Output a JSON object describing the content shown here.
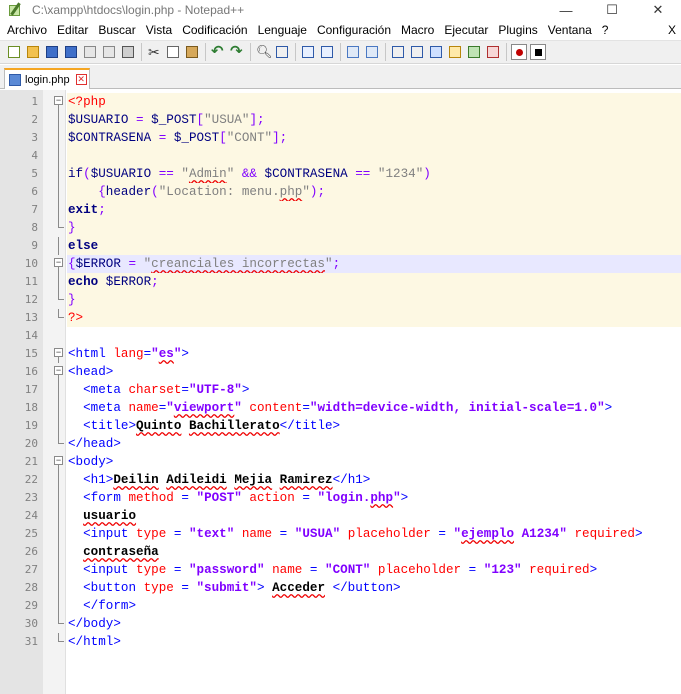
{
  "window": {
    "title": "C:\\xampp\\htdocs\\login.php - Notepad++",
    "minimize_glyph": "—",
    "maximize_glyph": "☐",
    "close_glyph": "✕"
  },
  "menu": {
    "items": [
      "Archivo",
      "Editar",
      "Buscar",
      "Vista",
      "Codificación",
      "Lenguaje",
      "Configuración",
      "Macro",
      "Ejecutar",
      "Plugins",
      "Ventana",
      "?"
    ],
    "close_doc": "X"
  },
  "toolbar": {
    "icons": [
      "new-file-icon",
      "open-file-icon",
      "save-icon",
      "save-all-icon",
      "close-icon",
      "close-all-icon",
      "print-icon",
      "cut-icon",
      "copy-icon",
      "paste-icon",
      "undo-icon",
      "redo-icon",
      "find-icon",
      "replace-icon",
      "zoom-in-icon",
      "zoom-out-icon",
      "sync-vertical-icon",
      "sync-horizontal-icon",
      "word-wrap-icon",
      "show-all-chars-icon",
      "indent-guide-icon",
      "user-lang-icon",
      "doc-map-icon",
      "function-list-icon",
      "record-macro-icon",
      "stop-macro-icon"
    ]
  },
  "tab": {
    "label": "login.php",
    "close_glyph": "✕"
  },
  "colors": {
    "php_bg": "#fdf8e3",
    "current_line_bg": "#e8e8ff",
    "tag": "#0000ff",
    "attribute": "#ff0000",
    "value": "#8000ff",
    "variable": "#000080",
    "string": "#808080",
    "tab_accent": "#f5a623"
  },
  "editor": {
    "lines": [
      {
        "n": "1",
        "t": [
          [
            "c-red",
            "<?php"
          ]
        ]
      },
      {
        "n": "2",
        "t": [
          [
            "c-var",
            "$USUARIO"
          ],
          [
            "c-op",
            " = "
          ],
          [
            "c-var",
            "$_POST"
          ],
          [
            "c-op",
            "["
          ],
          [
            "c-str",
            "\"USUA\""
          ],
          [
            "c-op",
            "];"
          ]
        ]
      },
      {
        "n": "3",
        "t": [
          [
            "c-var",
            "$CONTRASENA"
          ],
          [
            "c-op",
            " = "
          ],
          [
            "c-var",
            "$_POST"
          ],
          [
            "c-op",
            "["
          ],
          [
            "c-str",
            "\"CONT\""
          ],
          [
            "c-op",
            "];"
          ]
        ]
      },
      {
        "n": "4",
        "t": []
      },
      {
        "n": "5",
        "t": [
          [
            "c-kw",
            "if"
          ],
          [
            "c-op",
            "("
          ],
          [
            "c-var",
            "$USUARIO"
          ],
          [
            "c-op",
            " == "
          ],
          [
            "c-str",
            "\"Admin\""
          ],
          [
            "c-op",
            " && "
          ],
          [
            "c-var",
            "$CONTRASENA"
          ],
          [
            "c-op",
            " == "
          ],
          [
            "c-str",
            "\"1234\""
          ],
          [
            "c-op",
            ")"
          ]
        ]
      },
      {
        "n": "6",
        "t": [
          [
            "c-op",
            "    {"
          ],
          [
            "c-kw",
            "header"
          ],
          [
            "c-op",
            "("
          ],
          [
            "c-str",
            "\"Location: menu.php\""
          ],
          [
            "c-op",
            ");"
          ]
        ]
      },
      {
        "n": "7",
        "t": [
          [
            "c-kw c-bold",
            "exit"
          ],
          [
            "c-op",
            ";"
          ]
        ]
      },
      {
        "n": "8",
        "t": [
          [
            "c-op",
            "}"
          ]
        ]
      },
      {
        "n": "9",
        "t": [
          [
            "c-kw c-bold",
            "else"
          ]
        ]
      },
      {
        "n": "10",
        "t": [
          [
            "c-op",
            "{"
          ],
          [
            "c-var",
            "$ERROR"
          ],
          [
            "c-op",
            " = "
          ],
          [
            "c-str",
            "\"creanciales incorrectas\""
          ],
          [
            "c-op",
            ";"
          ]
        ]
      },
      {
        "n": "11",
        "t": [
          [
            "c-kw c-bold",
            "echo"
          ],
          [
            "c-var",
            " $ERROR"
          ],
          [
            "c-op",
            ";"
          ]
        ]
      },
      {
        "n": "12",
        "t": [
          [
            "c-op",
            "}"
          ]
        ]
      },
      {
        "n": "13",
        "t": [
          [
            "c-red",
            "?>"
          ]
        ]
      },
      {
        "n": "14",
        "t": []
      },
      {
        "n": "15",
        "t": [
          [
            "c-tag",
            "<html "
          ],
          [
            "c-attr",
            "lang"
          ],
          [
            "c-tag",
            "="
          ],
          [
            "c-val",
            "\"es\""
          ],
          [
            "c-tag",
            ">"
          ]
        ]
      },
      {
        "n": "16",
        "t": [
          [
            "c-tag",
            "<head>"
          ]
        ]
      },
      {
        "n": "17",
        "t": [
          [
            "c-tag",
            "  <meta "
          ],
          [
            "c-attr",
            "charset"
          ],
          [
            "c-tag",
            "="
          ],
          [
            "c-val",
            "\"UTF-8\""
          ],
          [
            "c-tag",
            ">"
          ]
        ]
      },
      {
        "n": "18",
        "t": [
          [
            "c-tag",
            "  <meta "
          ],
          [
            "c-attr",
            "name"
          ],
          [
            "c-tag",
            "="
          ],
          [
            "c-val",
            "\"viewport\""
          ],
          [
            "c-attr",
            " content"
          ],
          [
            "c-tag",
            "="
          ],
          [
            "c-val",
            "\"width=device-width, initial-scale=1.0\""
          ],
          [
            "c-tag",
            ">"
          ]
        ]
      },
      {
        "n": "19",
        "t": [
          [
            "c-tag",
            "  <title>"
          ],
          [
            "c-txt",
            "Quinto Bachillerato"
          ],
          [
            "c-tag",
            "</title>"
          ]
        ]
      },
      {
        "n": "20",
        "t": [
          [
            "c-tag",
            "</head>"
          ]
        ]
      },
      {
        "n": "21",
        "t": [
          [
            "c-tag",
            "<body>"
          ]
        ]
      },
      {
        "n": "22",
        "t": [
          [
            "c-tag",
            "  <h1>"
          ],
          [
            "c-txt",
            "Deilin Adileidi Mejia Ramirez"
          ],
          [
            "c-tag",
            "</h1>"
          ]
        ]
      },
      {
        "n": "23",
        "t": [
          [
            "c-tag",
            "  <form "
          ],
          [
            "c-attr",
            "method"
          ],
          [
            "c-tag",
            " = "
          ],
          [
            "c-val",
            "\"POST\""
          ],
          [
            "c-attr",
            " action"
          ],
          [
            "c-tag",
            " = "
          ],
          [
            "c-val",
            "\"login.php\""
          ],
          [
            "c-tag",
            ">"
          ]
        ]
      },
      {
        "n": "24",
        "t": [
          [
            "c-txt",
            "  usuario"
          ]
        ]
      },
      {
        "n": "25",
        "t": [
          [
            "c-tag",
            "  <input "
          ],
          [
            "c-attr",
            "type"
          ],
          [
            "c-tag",
            " = "
          ],
          [
            "c-val",
            "\"text\""
          ],
          [
            "c-attr",
            " name"
          ],
          [
            "c-tag",
            " = "
          ],
          [
            "c-val",
            "\"USUA\""
          ],
          [
            "c-attr",
            " placeholder"
          ],
          [
            "c-tag",
            " = "
          ],
          [
            "c-val",
            "\"ejemplo A1234\""
          ],
          [
            "c-attr",
            " required"
          ],
          [
            "c-tag",
            ">"
          ]
        ]
      },
      {
        "n": "26",
        "t": [
          [
            "c-txt",
            "  contraseña"
          ]
        ]
      },
      {
        "n": "27",
        "t": [
          [
            "c-tag",
            "  <input "
          ],
          [
            "c-attr",
            "type"
          ],
          [
            "c-tag",
            " = "
          ],
          [
            "c-val",
            "\"password\""
          ],
          [
            "c-attr",
            " name"
          ],
          [
            "c-tag",
            " = "
          ],
          [
            "c-val",
            "\"CONT\""
          ],
          [
            "c-attr",
            " placeholder"
          ],
          [
            "c-tag",
            " = "
          ],
          [
            "c-val",
            "\"123\""
          ],
          [
            "c-attr",
            " required"
          ],
          [
            "c-tag",
            ">"
          ]
        ]
      },
      {
        "n": "28",
        "t": [
          [
            "c-tag",
            "  <button "
          ],
          [
            "c-attr",
            "type"
          ],
          [
            "c-tag",
            " = "
          ],
          [
            "c-val",
            "\"submit\""
          ],
          [
            "c-tag",
            "> "
          ],
          [
            "c-txt",
            "Acceder "
          ],
          [
            "c-tag",
            "</button>"
          ]
        ]
      },
      {
        "n": "29",
        "t": [
          [
            "c-tag",
            "  </form>"
          ]
        ]
      },
      {
        "n": "30",
        "t": [
          [
            "c-tag",
            "</body>"
          ]
        ]
      },
      {
        "n": "31",
        "t": [
          [
            "c-tag",
            "</html>"
          ]
        ]
      }
    ]
  }
}
